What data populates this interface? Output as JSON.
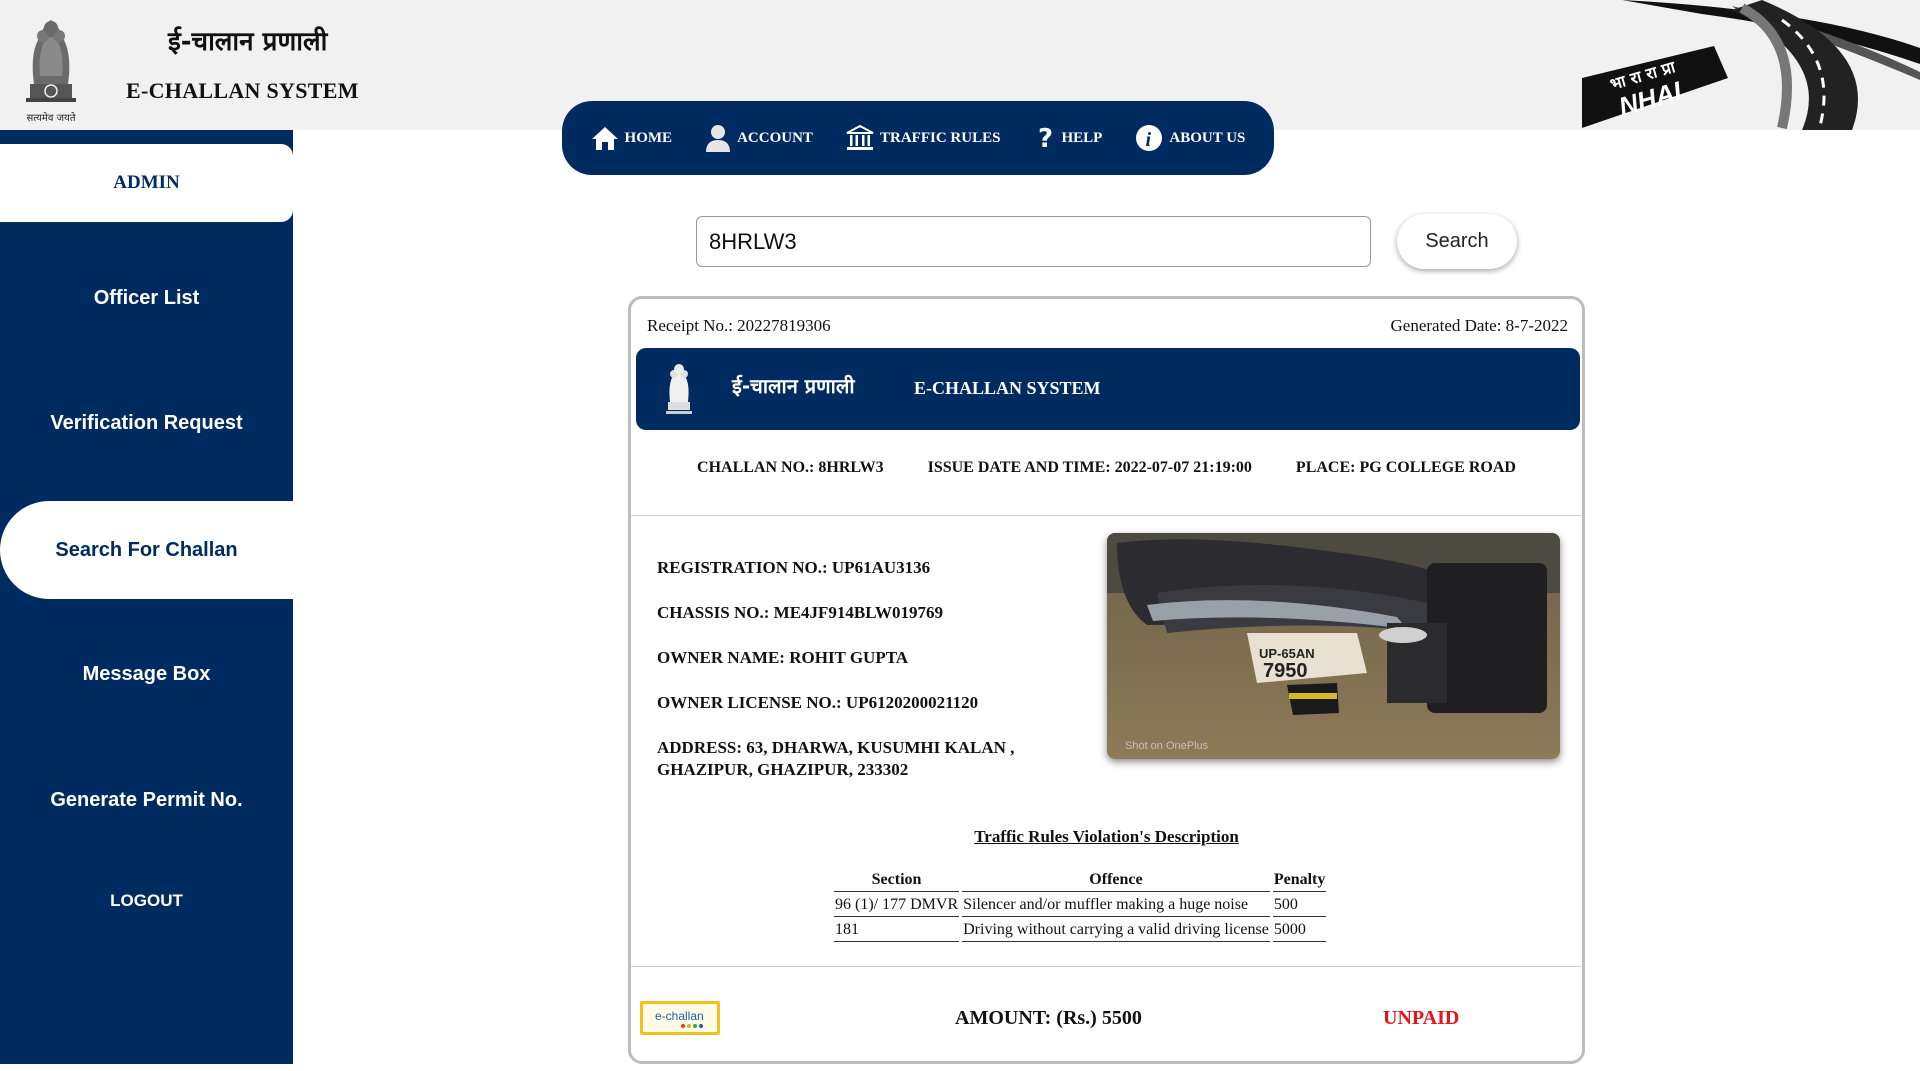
{
  "header": {
    "emblem_motto": "सत्यमेव जयते",
    "title_hindi": "ई-चालान प्रणाली",
    "title_english": "E-CHALLAN SYSTEM",
    "nhai_logo_text": "NHAI",
    "nhai_logo_hindi": "भा रा रा प्रा"
  },
  "nav": {
    "items": [
      {
        "label": "HOME",
        "icon": "home-icon"
      },
      {
        "label": "ACCOUNT",
        "icon": "user-icon"
      },
      {
        "label": "TRAFFIC RULES",
        "icon": "bank-icon"
      },
      {
        "label": "HELP",
        "icon": "question-icon"
      },
      {
        "label": "ABOUT US",
        "icon": "info-icon"
      }
    ]
  },
  "sidebar": {
    "admin": "ADMIN",
    "items": [
      {
        "label": "Officer List"
      },
      {
        "label": "Verification Request"
      },
      {
        "label": "Search For Challan",
        "active": true
      },
      {
        "label": "Message Box"
      },
      {
        "label": "Generate Permit No."
      },
      {
        "label": "LOGOUT"
      }
    ]
  },
  "search": {
    "value": "8HRLW3",
    "button": "Search"
  },
  "receipt": {
    "receipt_no": "Receipt No.: 20227819306",
    "generated_date": "Generated Date: 8-7-2022",
    "banner_hindi": "ई-चालान प्रणाली",
    "banner_english": "E-CHALLAN SYSTEM",
    "challan_no": "CHALLAN NO.: 8HRLW3",
    "issue_date": "ISSUE DATE AND TIME: 2022-07-07 21:19:00",
    "place": "PLACE: PG COLLEGE ROAD",
    "registration": "REGISTRATION NO.: UP61AU3136",
    "chassis": "CHASSIS NO.: ME4JF914BLW019769",
    "owner": "OWNER NAME: ROHIT GUPTA",
    "license": "OWNER LICENSE NO.: UP6120200021120",
    "address": "ADDRESS: 63, DHARWA, KUSUMHI KALAN , GHAZIPUR, GHAZIPUR, 233302",
    "photo_plate_top": "UP-65AN",
    "photo_plate_num": "7950",
    "photo_watermark": "Shot on OnePlus",
    "violation_title": "Traffic Rules Violation's Description",
    "table": {
      "headers": [
        "Section",
        "Offence",
        "Penalty"
      ],
      "rows": [
        [
          "96 (1)/ 177 DMVR",
          "Silencer and/or muffler making a huge noise",
          "500"
        ],
        [
          "181",
          "Driving without carrying a valid driving license",
          "5000"
        ]
      ]
    },
    "echallan_logo": "e-challan",
    "amount": "AMOUNT: (Rs.) 5500",
    "status": "UNPAID"
  },
  "colors": {
    "navy": "#002b61",
    "unpaid_red": "#e8141b",
    "logo_gold": "#f2c21b"
  }
}
